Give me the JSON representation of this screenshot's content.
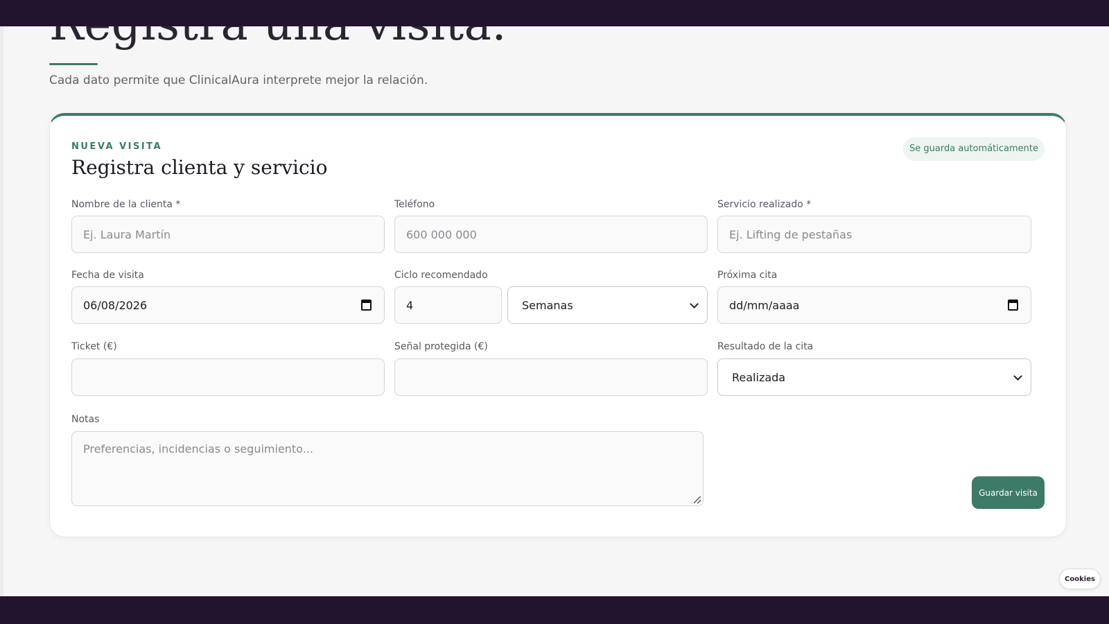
{
  "hero": {
    "title": "Registra una visita.",
    "subtitle": "Cada dato permite que ClinicalAura interprete mejor la relación."
  },
  "card": {
    "eyebrow": "NUEVA VISITA",
    "title": "Registra clienta y servicio",
    "autosave_badge": "Se guarda automáticamente"
  },
  "fields": {
    "client_name": {
      "label": "Nombre de la clienta *",
      "placeholder": "Ej. Laura Martín"
    },
    "phone": {
      "label": "Teléfono",
      "placeholder": "600 000 000"
    },
    "service": {
      "label": "Servicio realizado *",
      "placeholder": "Ej. Lifting de pestañas"
    },
    "visit_date": {
      "label": "Fecha de visita",
      "value": "06/08/2026"
    },
    "cycle": {
      "label": "Ciclo recomendado",
      "value": "4",
      "unit": "Semanas"
    },
    "next_appointment": {
      "label": "Próxima cita",
      "value": "dd/mm/aaaa"
    },
    "ticket": {
      "label": "Ticket (€)",
      "value": ""
    },
    "deposit": {
      "label": "Señal protegida (€)",
      "value": ""
    },
    "result": {
      "label": "Resultado de la cita",
      "value": "Realizada"
    },
    "notes": {
      "label": "Notas",
      "placeholder": "Preferencias, incidencias o seguimiento..."
    }
  },
  "actions": {
    "save": "Guardar visita"
  },
  "cookies": "Cookies",
  "colors": {
    "accent": "#3d7a67",
    "frame": "#22132e",
    "badge_bg": "#eef5f1"
  }
}
